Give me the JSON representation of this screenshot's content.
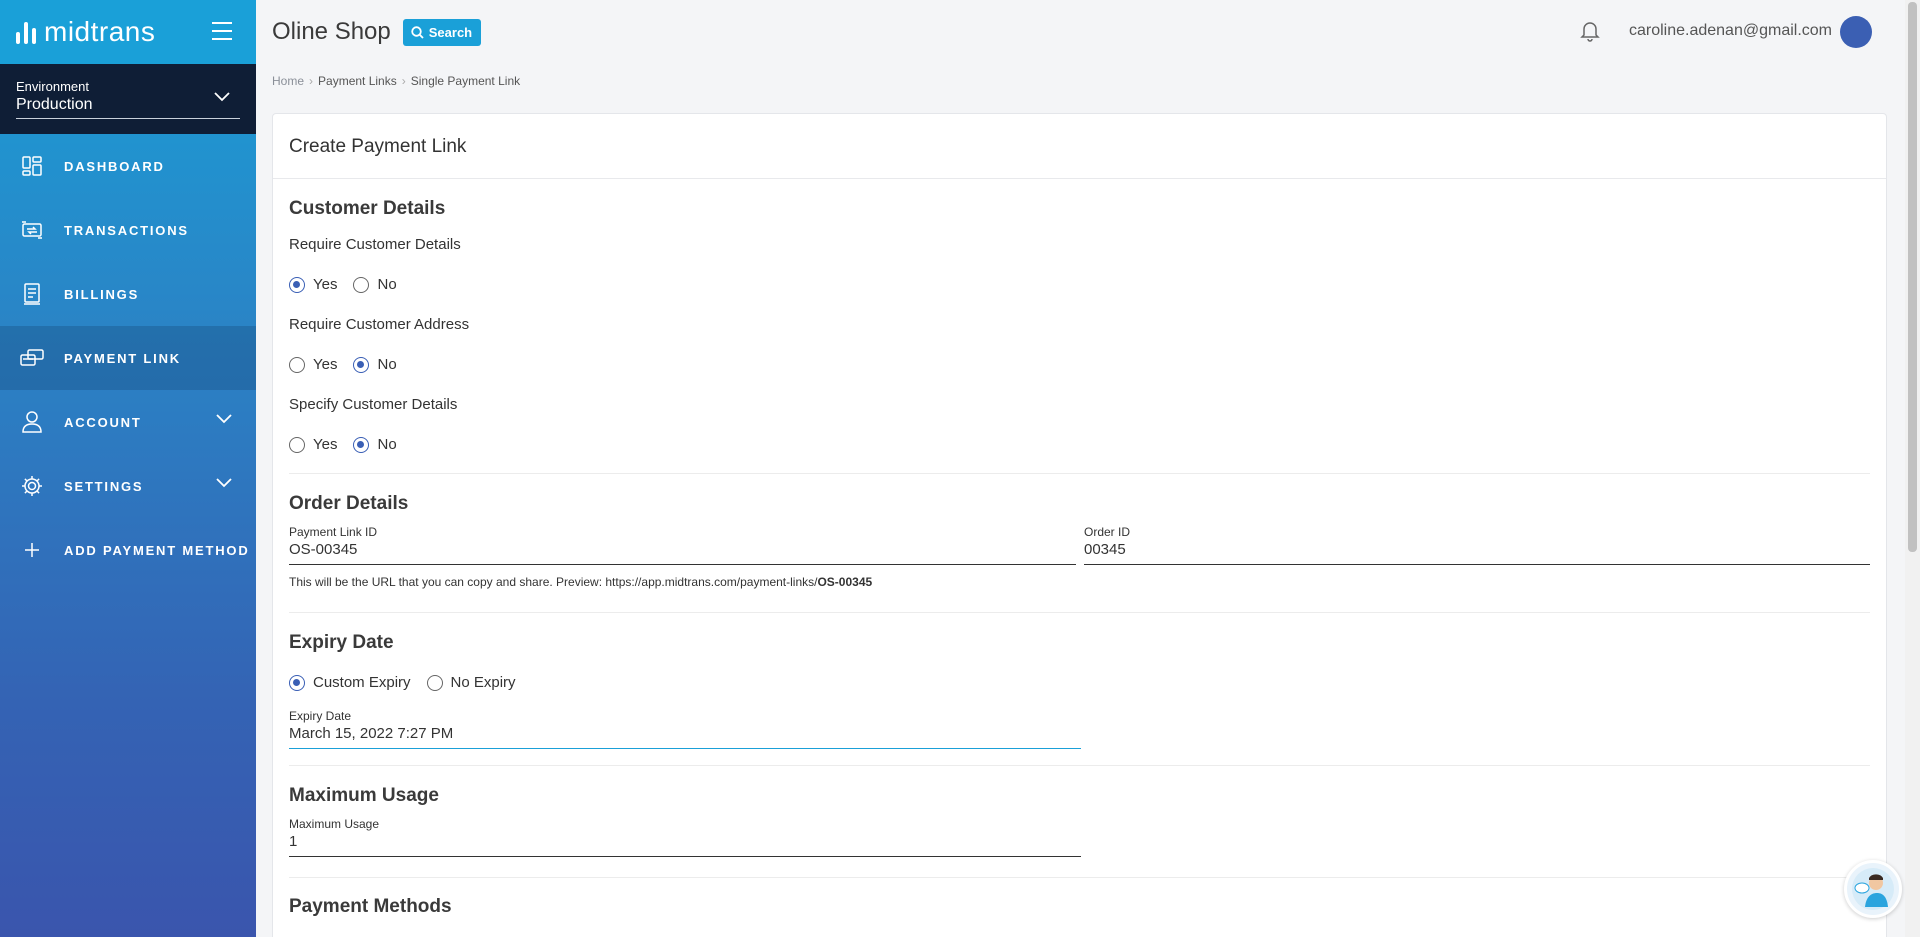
{
  "brand": {
    "name": "midtrans"
  },
  "environment": {
    "label": "Environment",
    "value": "Production"
  },
  "sidebar": {
    "items": [
      {
        "label": "DASHBOARD",
        "icon": "dashboard-icon"
      },
      {
        "label": "TRANSACTIONS",
        "icon": "transactions-icon"
      },
      {
        "label": "BILLINGS",
        "icon": "billings-icon"
      },
      {
        "label": "PAYMENT LINK",
        "icon": "payment-link-icon",
        "active": true
      },
      {
        "label": "ACCOUNT",
        "icon": "account-icon",
        "expandable": true
      },
      {
        "label": "SETTINGS",
        "icon": "settings-icon",
        "expandable": true
      },
      {
        "label": "ADD PAYMENT METHOD",
        "icon": "plus-icon"
      }
    ]
  },
  "header": {
    "title": "Oline Shop",
    "search_label": "Search",
    "user_email": "caroline.adenan@gmail.com"
  },
  "breadcrumb": [
    "Home",
    "Payment Links",
    "Single Payment Link"
  ],
  "card": {
    "title": "Create Payment Link",
    "customer": {
      "title": "Customer Details",
      "questions": [
        {
          "label": "Require Customer Details",
          "yes": "Yes",
          "no": "No",
          "selected": "Yes"
        },
        {
          "label": "Require Customer Address",
          "yes": "Yes",
          "no": "No",
          "selected": "No"
        },
        {
          "label": "Specify Customer Details",
          "yes": "Yes",
          "no": "No",
          "selected": "No"
        }
      ]
    },
    "order": {
      "title": "Order Details",
      "link_id_label": "Payment Link ID",
      "link_id_value": "OS-00345",
      "order_id_label": "Order ID",
      "order_id_value": "00345",
      "help_prefix": "This will be the URL that you can copy and share. Preview: https://app.midtrans.com/payment-links/",
      "help_bold": "OS-00345"
    },
    "expiry": {
      "title": "Expiry Date",
      "option_custom": "Custom Expiry",
      "option_none": "No Expiry",
      "selected": "Custom Expiry",
      "field_label": "Expiry Date",
      "field_value": "March 15, 2022 7:27 PM"
    },
    "max_usage": {
      "title": "Maximum Usage",
      "field_label": "Maximum Usage",
      "field_value": "1"
    },
    "payment_methods": {
      "title": "Payment Methods"
    }
  },
  "colors": {
    "accent": "#1aa0d8",
    "radio": "#3a5fb5",
    "env_bg": "#0f1e36"
  }
}
